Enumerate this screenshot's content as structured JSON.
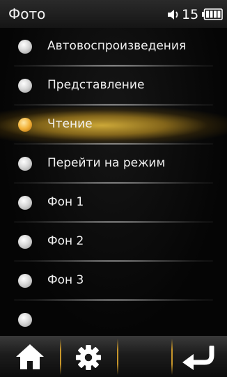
{
  "status_bar": {
    "title": "Фото",
    "volume": "15",
    "speaker_icon": "speaker-icon",
    "battery_icon": "battery-icon"
  },
  "menu": {
    "items": [
      {
        "label": "Автовоспроизведения",
        "selected": false
      },
      {
        "label": "Представление",
        "selected": false
      },
      {
        "label": "Чтение",
        "selected": true
      },
      {
        "label": "Перейти на режим",
        "selected": false
      },
      {
        "label": "Фон 1",
        "selected": false
      },
      {
        "label": "Фон 2",
        "selected": false
      },
      {
        "label": "Фон 3",
        "selected": false
      },
      {
        "label": "",
        "selected": false
      }
    ]
  },
  "toolbar": {
    "buttons": [
      {
        "icon": "home-icon"
      },
      {
        "icon": "gear-icon"
      },
      {
        "icon": ""
      },
      {
        "icon": "back-arrow-icon"
      }
    ]
  },
  "colors": {
    "highlight": "#d6b03a",
    "separator": "#c8962a",
    "background": "#050505"
  }
}
